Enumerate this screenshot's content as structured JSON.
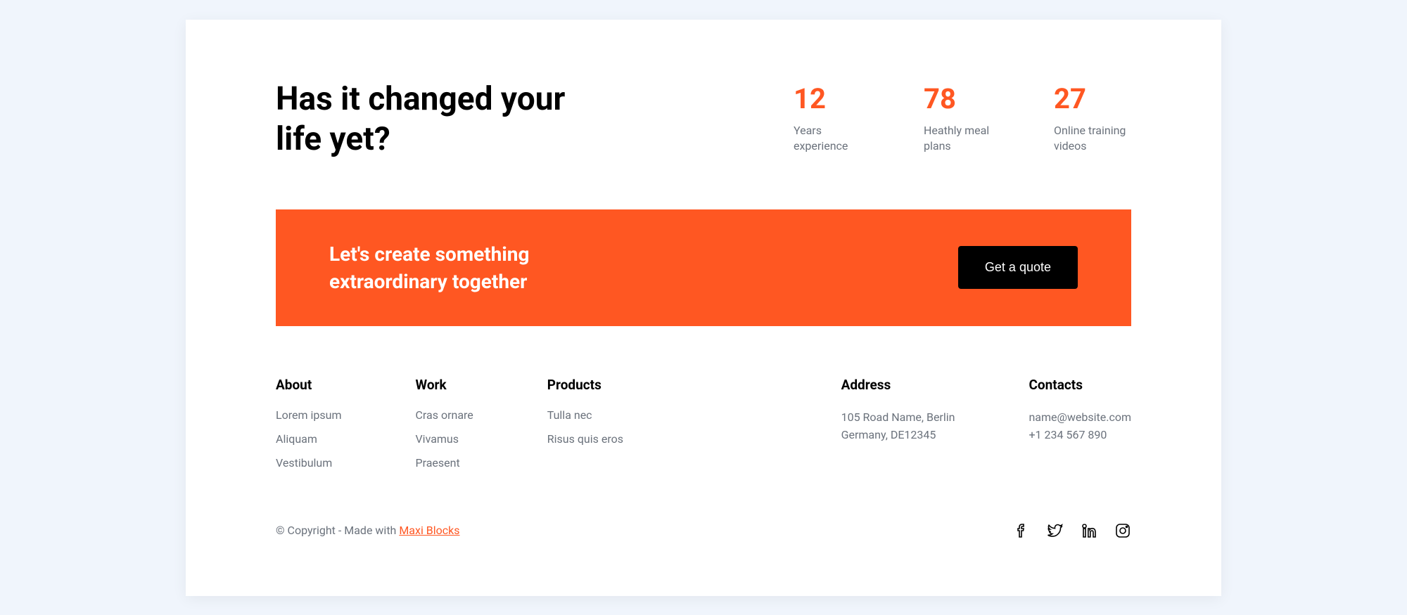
{
  "headline": "Has it changed your life yet?",
  "stats": [
    {
      "number": "12",
      "label": "Years experience"
    },
    {
      "number": "78",
      "label": "Heathly meal plans"
    },
    {
      "number": "27",
      "label": "Online training videos"
    }
  ],
  "cta": {
    "text": "Let's create something extraordinary together",
    "button": "Get a quote"
  },
  "footer": {
    "about": {
      "heading": "About",
      "links": [
        "Lorem ipsum",
        "Aliquam",
        "Vestibulum"
      ]
    },
    "work": {
      "heading": "Work",
      "links": [
        "Cras ornare",
        "Vivamus",
        "Praesent"
      ]
    },
    "products": {
      "heading": "Products",
      "links": [
        "Tulla nec",
        "Risus quis eros"
      ]
    },
    "address": {
      "heading": "Address",
      "line1": "105 Road Name, Berlin",
      "line2": "Germany, DE12345"
    },
    "contacts": {
      "heading": "Contacts",
      "email": "name@website.com",
      "phone": "+1 234 567 890"
    }
  },
  "copyright": {
    "prefix": "© Copyright - Made with ",
    "link": "Maxi Blocks"
  }
}
